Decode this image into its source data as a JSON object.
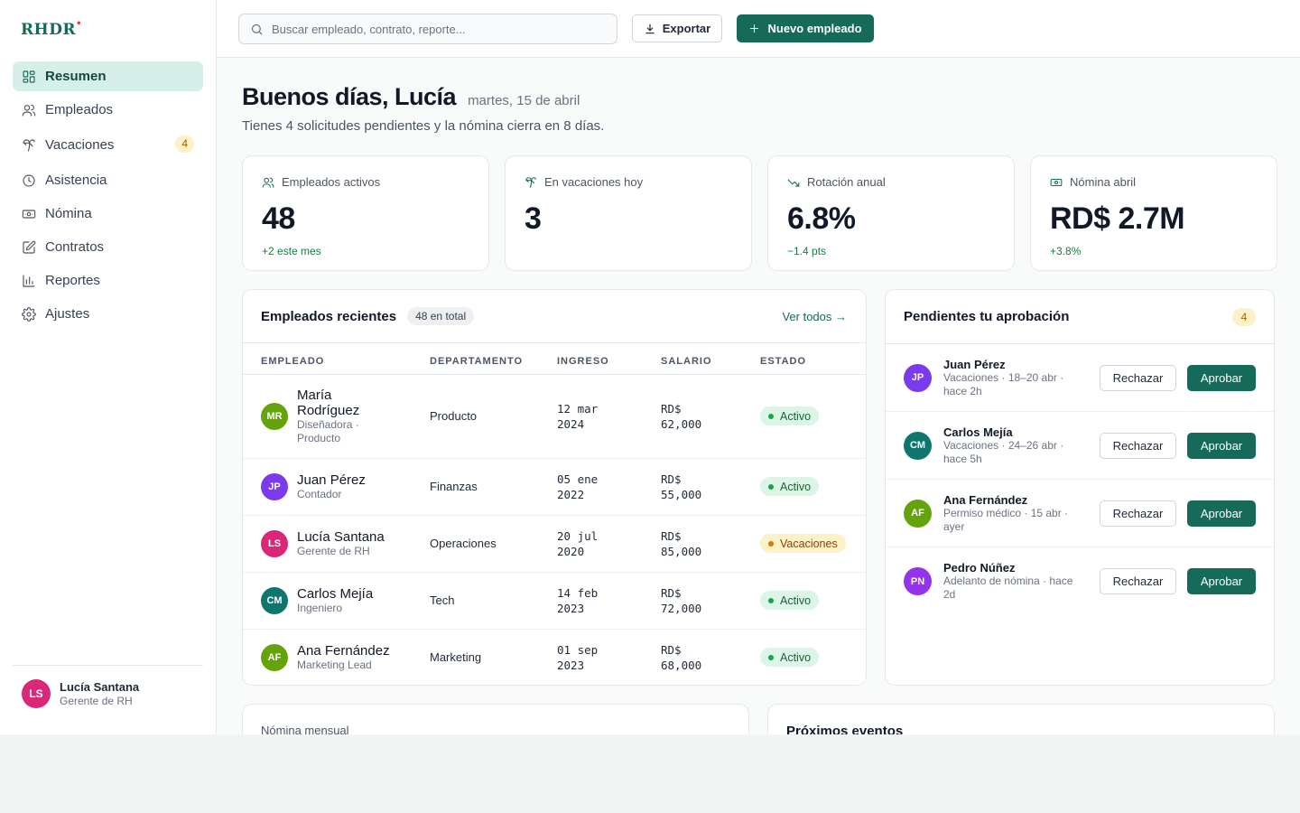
{
  "brand": {
    "name": "RHDR",
    "mark": "•",
    "accent": "#166a5a"
  },
  "sidebar": {
    "items": [
      {
        "label": "Resumen",
        "icon": "dashboard-icon",
        "active": true
      },
      {
        "label": "Empleados",
        "icon": "users-icon"
      },
      {
        "label": "Vacaciones",
        "icon": "palm-tree-icon",
        "badge": "4"
      },
      {
        "label": "Asistencia",
        "icon": "clock-icon"
      },
      {
        "label": "Nómina",
        "icon": "banknote-icon"
      },
      {
        "label": "Contratos",
        "icon": "edit-document-icon"
      },
      {
        "label": "Reportes",
        "icon": "bar-chart-icon"
      },
      {
        "label": "Ajustes",
        "icon": "gear-icon"
      }
    ],
    "user": {
      "initials": "LS",
      "name": "Lucía Santana",
      "role": "Gerente de RH",
      "color": "#db2777"
    }
  },
  "topbar": {
    "search_placeholder": "Buscar empleado, contrato, reporte...",
    "export_label": "Exportar",
    "new_label": "Nuevo empleado"
  },
  "header": {
    "greeting": "Buenos días, Lucía",
    "date": "martes, 15 de abril",
    "subtitle": "Tienes 4 solicitudes pendientes y la nómina cierra en 8 días."
  },
  "stats": [
    {
      "label": "Empleados activos",
      "value": "48",
      "delta": "+2 este mes",
      "icon": "users-icon"
    },
    {
      "label": "En vacaciones hoy",
      "value": "3",
      "delta": "",
      "icon": "palm-tree-icon"
    },
    {
      "label": "Rotación anual",
      "value": "6.8%",
      "delta": "−1.4 pts",
      "icon": "trend-down-icon"
    },
    {
      "label": "Nómina abril",
      "value": "RD$ 2.7M",
      "delta": "+3.8%",
      "icon": "banknote-icon"
    }
  ],
  "recent": {
    "title": "Empleados recientes",
    "count": "48 en total",
    "see_all": "Ver todos →",
    "columns": [
      "EMPLEADO",
      "DEPARTAMENTO",
      "INGRESO",
      "SALARIO",
      "ESTADO"
    ],
    "rows": [
      {
        "initials": "MR",
        "color": "#65a30d",
        "name": "María Rodríguez",
        "role": "Diseñadora · Producto",
        "dept": "Producto",
        "date": "12 mar 2024",
        "salary": "RD$ 62,000",
        "status": "Activo",
        "status_type": "ok"
      },
      {
        "initials": "JP",
        "color": "#7c3aed",
        "name": "Juan Pérez",
        "role": "Contador",
        "dept": "Finanzas",
        "date": "05 ene 2022",
        "salary": "RD$ 55,000",
        "status": "Activo",
        "status_type": "ok"
      },
      {
        "initials": "LS",
        "color": "#db2777",
        "name": "Lucía Santana",
        "role": "Gerente de RH",
        "dept": "Operaciones",
        "date": "20 jul 2020",
        "salary": "RD$ 85,000",
        "status": "Vacaciones",
        "status_type": "vac"
      },
      {
        "initials": "CM",
        "color": "#0f766e",
        "name": "Carlos Mejía",
        "role": "Ingeniero",
        "dept": "Tech",
        "date": "14 feb 2023",
        "salary": "RD$ 72,000",
        "status": "Activo",
        "status_type": "ok"
      },
      {
        "initials": "AF",
        "color": "#65a30d",
        "name": "Ana Fernández",
        "role": "Marketing Lead",
        "dept": "Marketing",
        "date": "01 sep 2023",
        "salary": "RD$ 68,000",
        "status": "Activo",
        "status_type": "ok"
      }
    ]
  },
  "pending": {
    "title": "Pendientes tu aprobación",
    "count": "4",
    "reject_label": "Rechazar",
    "approve_label": "Aprobar",
    "requests": [
      {
        "initials": "JP",
        "color": "#7c3aed",
        "name": "Juan Pérez",
        "detail": "Vacaciones · 18–20 abr · hace 2h"
      },
      {
        "initials": "CM",
        "color": "#0f766e",
        "name": "Carlos Mejía",
        "detail": "Vacaciones · 24–26 abr · hace 5h"
      },
      {
        "initials": "AF",
        "color": "#65a30d",
        "name": "Ana Fernández",
        "detail": "Permiso médico · 15 abr · ayer"
      },
      {
        "initials": "PN",
        "color": "#9333ea",
        "name": "Pedro Núñez",
        "detail": "Adelanto de nómina · hace 2d"
      }
    ]
  },
  "payroll": {
    "title": "Nómina mensual"
  },
  "events": {
    "title": "Próximos eventos"
  }
}
